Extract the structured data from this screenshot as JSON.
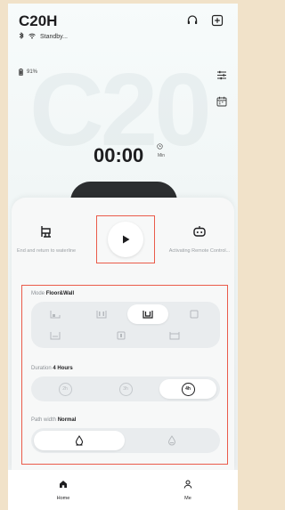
{
  "app": {
    "title": "C20H",
    "status": "Standby..."
  },
  "battery": {
    "percent": "91%"
  },
  "timer": {
    "value": "00:00",
    "unit": "Min"
  },
  "actions": {
    "end_return": "End and return to waterline",
    "remote": "Activating Remote Control..."
  },
  "mode": {
    "label": "Mode",
    "value": "Floor&Wall",
    "selected_index": 2
  },
  "duration": {
    "label": "Duration",
    "value": "4 Hours",
    "options": [
      "2h",
      "3h",
      "4h"
    ],
    "selected_index": 2
  },
  "path_width": {
    "label": "Path width",
    "value": "Normal",
    "selected_index": 0
  },
  "tabs": {
    "home": "Home",
    "me": "Me"
  },
  "colors": {
    "highlight": "#ea5b4a",
    "text": "#1d1d1f"
  }
}
